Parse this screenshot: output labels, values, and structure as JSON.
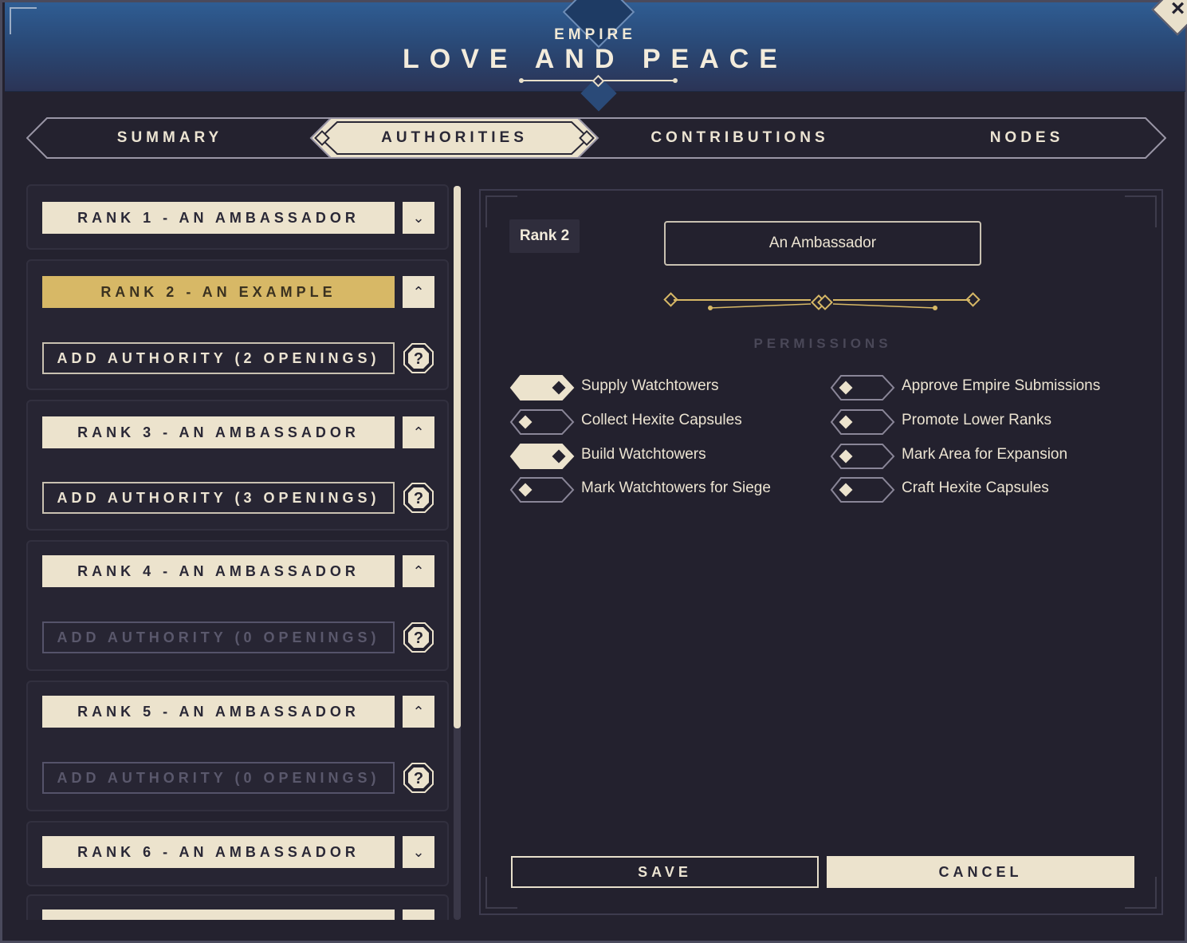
{
  "header": {
    "subtitle": "EMPIRE",
    "title": "LOVE AND PEACE"
  },
  "close_icon": "close-icon",
  "tabs": [
    {
      "label": "SUMMARY",
      "active": false
    },
    {
      "label": "AUTHORITIES",
      "active": true
    },
    {
      "label": "CONTRIBUTIONS",
      "active": false
    },
    {
      "label": "NODES",
      "active": false
    }
  ],
  "ranks": [
    {
      "label": "RANK 1 - AN AMBASSADOR",
      "expanded": false,
      "selected": false
    },
    {
      "label": "RANK 2 - AN EXAMPLE",
      "expanded": true,
      "selected": true,
      "add_label": "ADD AUTHORITY (2 OPENINGS)",
      "add_enabled": true
    },
    {
      "label": "RANK 3 - AN AMBASSADOR",
      "expanded": true,
      "selected": false,
      "add_label": "ADD AUTHORITY (3 OPENINGS)",
      "add_enabled": true
    },
    {
      "label": "RANK 4 - AN AMBASSADOR",
      "expanded": true,
      "selected": false,
      "add_label": "ADD AUTHORITY (0 OPENINGS)",
      "add_enabled": false
    },
    {
      "label": "RANK 5 - AN AMBASSADOR",
      "expanded": true,
      "selected": false,
      "add_label": "ADD AUTHORITY (0 OPENINGS)",
      "add_enabled": false
    },
    {
      "label": "RANK 6 - AN AMBASSADOR",
      "expanded": false,
      "selected": false
    }
  ],
  "detail": {
    "rank_label": "Rank 2",
    "name_value": "An Ambassador",
    "permissions_title": "PERMISSIONS",
    "permissions": [
      {
        "label": "Supply Watchtowers",
        "enabled": true
      },
      {
        "label": "Approve Empire Submissions",
        "enabled": false
      },
      {
        "label": "Collect Hexite Capsules",
        "enabled": false
      },
      {
        "label": "Promote Lower Ranks",
        "enabled": false
      },
      {
        "label": "Build Watchtowers",
        "enabled": true
      },
      {
        "label": "Mark Area for Expansion",
        "enabled": false
      },
      {
        "label": "Mark Watchtowers for Siege",
        "enabled": false
      },
      {
        "label": "Craft Hexite Capsules",
        "enabled": false
      }
    ],
    "save_label": "SAVE",
    "cancel_label": "CANCEL"
  },
  "colors": {
    "accent_gold": "#d7b866",
    "cream": "#ece3cd",
    "panel": "#24222f"
  }
}
